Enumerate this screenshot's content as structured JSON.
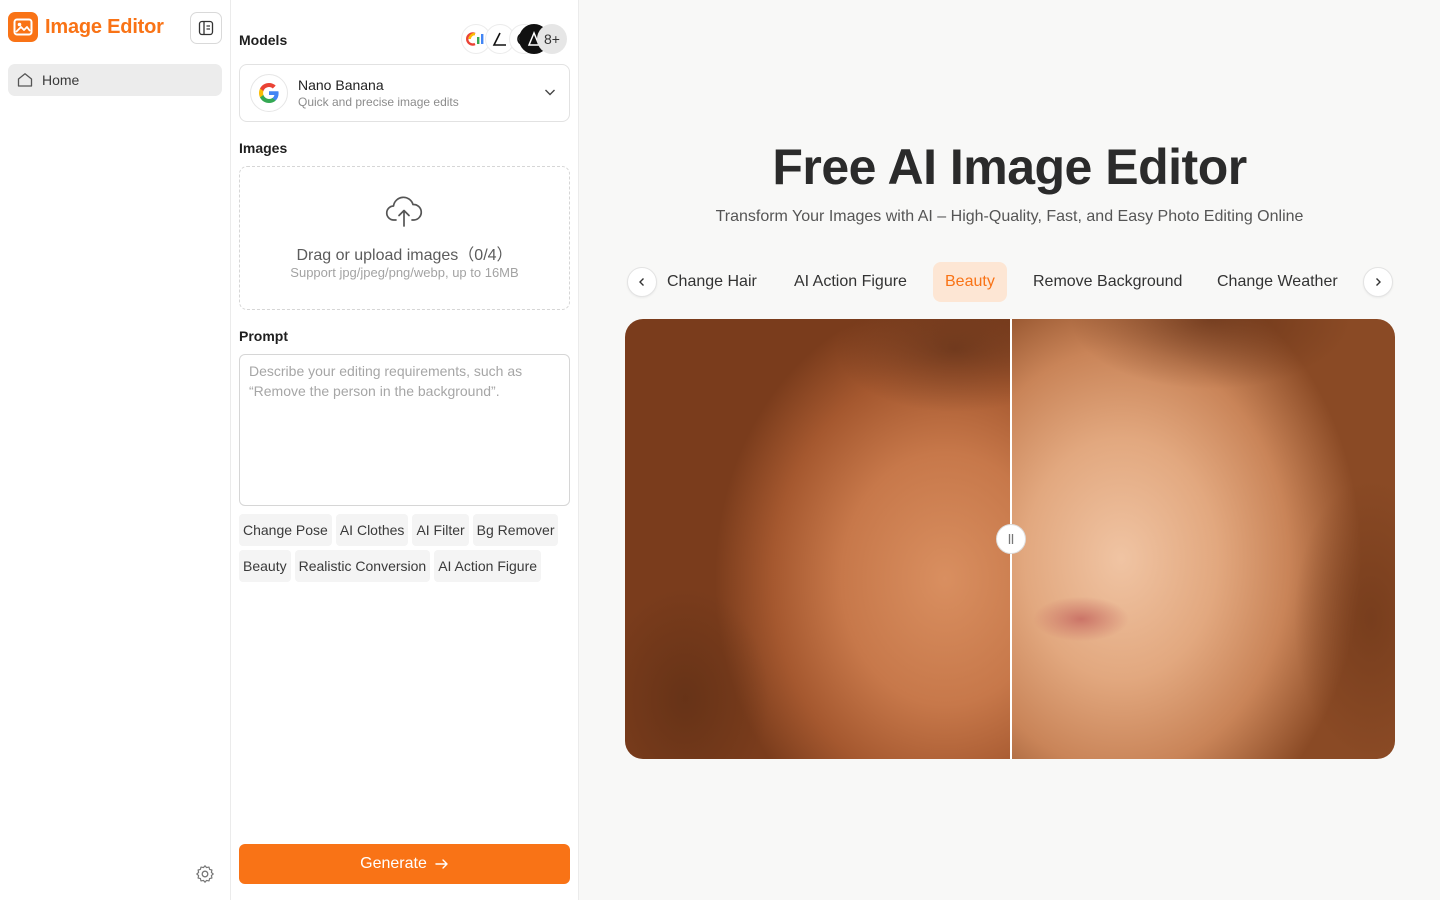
{
  "brand": {
    "name": "Image Editor"
  },
  "nav": {
    "home_label": "Home"
  },
  "models": {
    "label": "Models",
    "more_count": "8+",
    "icons": [
      "gemini-icon",
      "flux-icon",
      "openai-icon",
      "seedream-icon"
    ],
    "selected": {
      "name": "Nano Banana",
      "description": "Quick and precise image edits",
      "icon": "google-icon"
    }
  },
  "images": {
    "label": "Images",
    "upload_title": "Drag or upload images（0/4）",
    "upload_sub": "Support jpg/jpeg/png/webp, up to 16MB"
  },
  "prompt": {
    "label": "Prompt",
    "placeholder": "Describe your editing requirements, such as “Remove the person in the background”."
  },
  "chips": [
    "Change Pose",
    "AI Clothes",
    "AI Filter",
    "Bg Remover",
    "Beauty",
    "Realistic Conversion",
    "AI Action Figure"
  ],
  "generate_label": "Generate",
  "hero": {
    "title": "Free AI Image Editor",
    "subtitle": "Transform Your Images with AI – High-Quality, Fast, and Easy Photo Editing Online"
  },
  "tabs": [
    "Change Hair",
    "AI Action Figure",
    "Beauty",
    "Remove Background",
    "Change Weather"
  ],
  "active_tab": "Beauty",
  "colors": {
    "accent": "#f97316",
    "accent_soft": "#fde6d4",
    "main_bg": "#f8f8f7"
  }
}
